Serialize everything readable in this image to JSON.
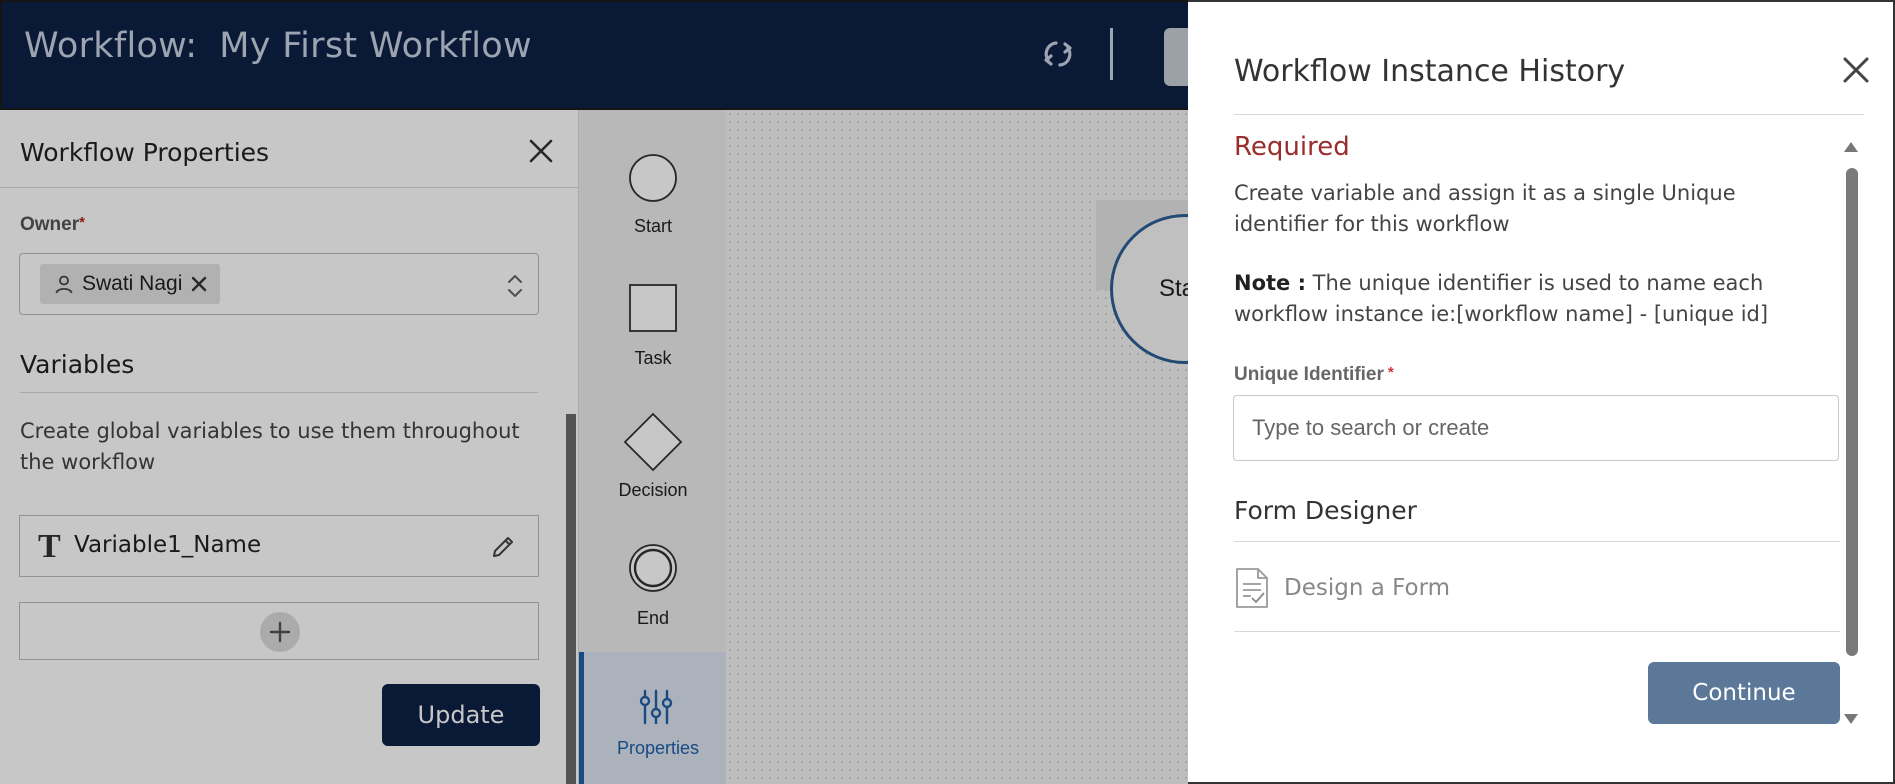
{
  "header": {
    "title_prefix": "Workflow:",
    "workflow_name": "My First Workflow",
    "refresh_icon": "refresh-icon",
    "bg_color": "#0d2145"
  },
  "properties_panel": {
    "title": "Workflow Properties",
    "owner_label": "Owner",
    "owner_required_mark": "*",
    "owner_value": "Swati Nagi",
    "variables_title": "Variables",
    "variables_description": "Create global variables to use them throughout the workflow",
    "variables": [
      {
        "type_glyph": "T",
        "name": "Variable1_Name"
      }
    ],
    "update_label": "Update"
  },
  "palette": {
    "items": [
      {
        "label": "Start",
        "icon": "start-circle-icon"
      },
      {
        "label": "Task",
        "icon": "task-square-icon"
      },
      {
        "label": "Decision",
        "icon": "decision-diamond-icon"
      },
      {
        "label": "End",
        "icon": "end-circle-icon"
      },
      {
        "label": "Properties",
        "icon": "sliders-icon",
        "active": true
      }
    ]
  },
  "canvas": {
    "start_node_label": "Sta"
  },
  "modal": {
    "title": "Workflow Instance History",
    "required_title": "Required",
    "required_description": "Create variable and assign it as a single Unique identifier for this workflow",
    "note_label": "Note :",
    "note_text": " The unique identifier is used to name each workflow instance ie:[workflow name] - [unique id]",
    "unique_identifier_label": "Unique Identifier",
    "unique_identifier_required_mark": "*",
    "unique_identifier_placeholder": "Type to search or create",
    "unique_identifier_value": "",
    "form_designer_title": "Form Designer",
    "design_form_label": "Design a Form",
    "continue_label": "Continue",
    "required_color": "#9b2c2c",
    "continue_color": "#5b7898"
  }
}
